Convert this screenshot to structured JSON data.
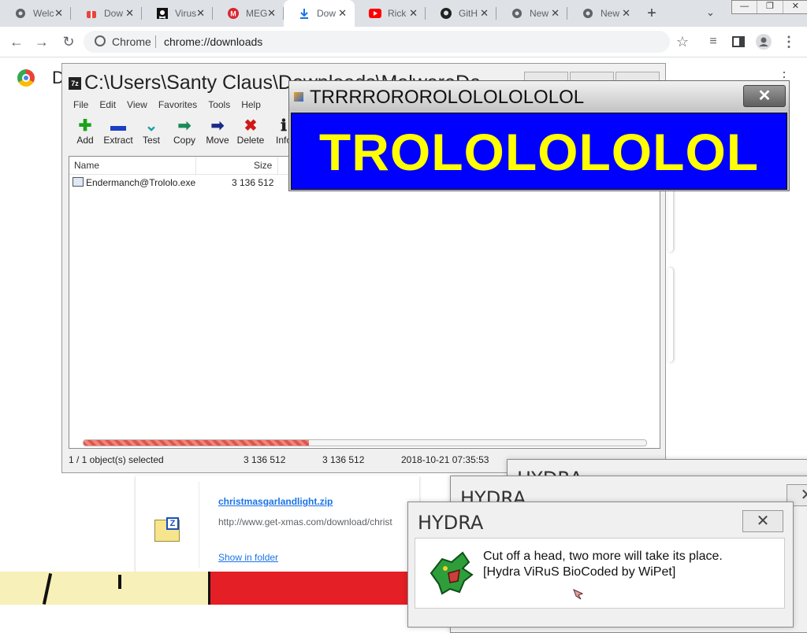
{
  "browser": {
    "tabs": [
      {
        "label": "Welc",
        "icon": "chrome-globe-icon",
        "active": false
      },
      {
        "label": "Dow",
        "icon": "gift-icon",
        "active": false
      },
      {
        "label": "Virus",
        "icon": "pirate-flag-icon",
        "active": false
      },
      {
        "label": "MEG",
        "icon": "mega-icon",
        "active": false
      },
      {
        "label": "Dow",
        "icon": "download-icon",
        "active": true
      },
      {
        "label": "Rick",
        "icon": "youtube-icon",
        "active": false
      },
      {
        "label": "GitH",
        "icon": "github-icon",
        "active": false
      },
      {
        "label": "New",
        "icon": "chrome-globe-icon",
        "active": false
      },
      {
        "label": "New",
        "icon": "chrome-globe-icon",
        "active": false
      }
    ],
    "omnibox": {
      "site": "Chrome",
      "url": "chrome://downloads"
    }
  },
  "downloads": {
    "title": "D",
    "item": {
      "filename": "christmasgarlandlight.zip",
      "url": "http://www.get-xmas.com/download/christ",
      "show_in_folder": "Show in folder"
    }
  },
  "sevenzip": {
    "title": "C:\\Users\\Santy Claus\\Downloads\\MalwareDe",
    "app_icon": "7z",
    "menu": [
      "File",
      "Edit",
      "View",
      "Favorites",
      "Tools",
      "Help"
    ],
    "tools": [
      {
        "label": "Add",
        "icon": "plus-icon",
        "color": "#19a319"
      },
      {
        "label": "Extract",
        "icon": "minus-icon",
        "color": "#1a3fc7"
      },
      {
        "label": "Test",
        "icon": "check-icon",
        "color": "#1aa0a6"
      },
      {
        "label": "Copy",
        "icon": "copy-arrow-icon",
        "color": "#1a8a5a"
      },
      {
        "label": "Move",
        "icon": "move-arrow-icon",
        "color": "#1a2a8a"
      },
      {
        "label": "Delete",
        "icon": "delete-x-icon",
        "color": "#d01818"
      },
      {
        "label": "Info",
        "icon": "info-icon",
        "color": "#222222"
      }
    ],
    "columns": {
      "name": "Name",
      "size": "Size"
    },
    "rows": [
      {
        "name": "Endermanch@Trololo.exe",
        "size": "3 136 512"
      }
    ],
    "progress": 0.4,
    "status": {
      "selected": "1 / 1 object(s) selected",
      "size1": "3 136 512",
      "size2": "3 136 512",
      "date": "2018-10-21 07:35:53"
    }
  },
  "trololo": {
    "title": "TRRRROROROLOLOLOLOLOL",
    "banner": "TROLOLOLOLOL",
    "colors": {
      "background": "#0000ff",
      "text": "#ffff00"
    }
  },
  "hydra": {
    "title": "HYDRA",
    "message_line1": "Cut off a head, two more will take its place.",
    "message_line2": "[Hydra ViRuS BioCoded by WiPet]"
  }
}
